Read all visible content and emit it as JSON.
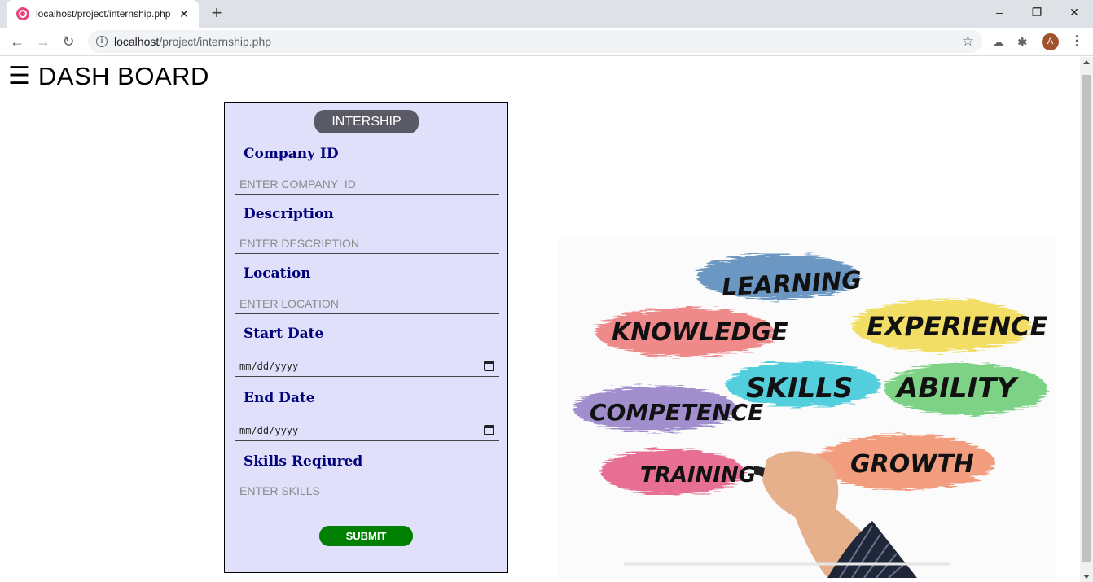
{
  "browser": {
    "tab_title": "localhost/project/internship.php",
    "tab_close": "✕",
    "new_tab": "+",
    "url_host": "localhost",
    "url_path": "/project/internship.php",
    "avatar_letter": "A",
    "window_controls": [
      "–",
      "❐",
      "✕"
    ]
  },
  "header": {
    "menu_glyph": "☰",
    "title": "DASH BOARD"
  },
  "form": {
    "heading": "INTERSHIP",
    "fields": [
      {
        "label": "Company ID",
        "placeholder": "ENTER COMPANY_ID"
      },
      {
        "label": "Description",
        "placeholder": "ENTER DESCRIPTION"
      },
      {
        "label": "Location",
        "placeholder": "ENTER LOCATION"
      },
      {
        "label": "Start Date",
        "value": "mm/dd/yyyy"
      },
      {
        "label": "End Date",
        "value": "mm/dd/yyyy"
      },
      {
        "label": "Skills Reqiured",
        "placeholder": "ENTER SKILLS"
      }
    ],
    "submit_label": "SUBMIT"
  },
  "image": {
    "words": [
      "LEARNING",
      "KNOWLEDGE",
      "EXPERIENCE",
      "SKILLS",
      "ABILITY",
      "COMPETENCE",
      "TRAINING",
      "GROWTH"
    ]
  },
  "colors": {
    "panel_bg": "#e0e0fb",
    "label": "#00007a",
    "heading_bg": "#5a5a66",
    "submit_bg": "#008000"
  }
}
